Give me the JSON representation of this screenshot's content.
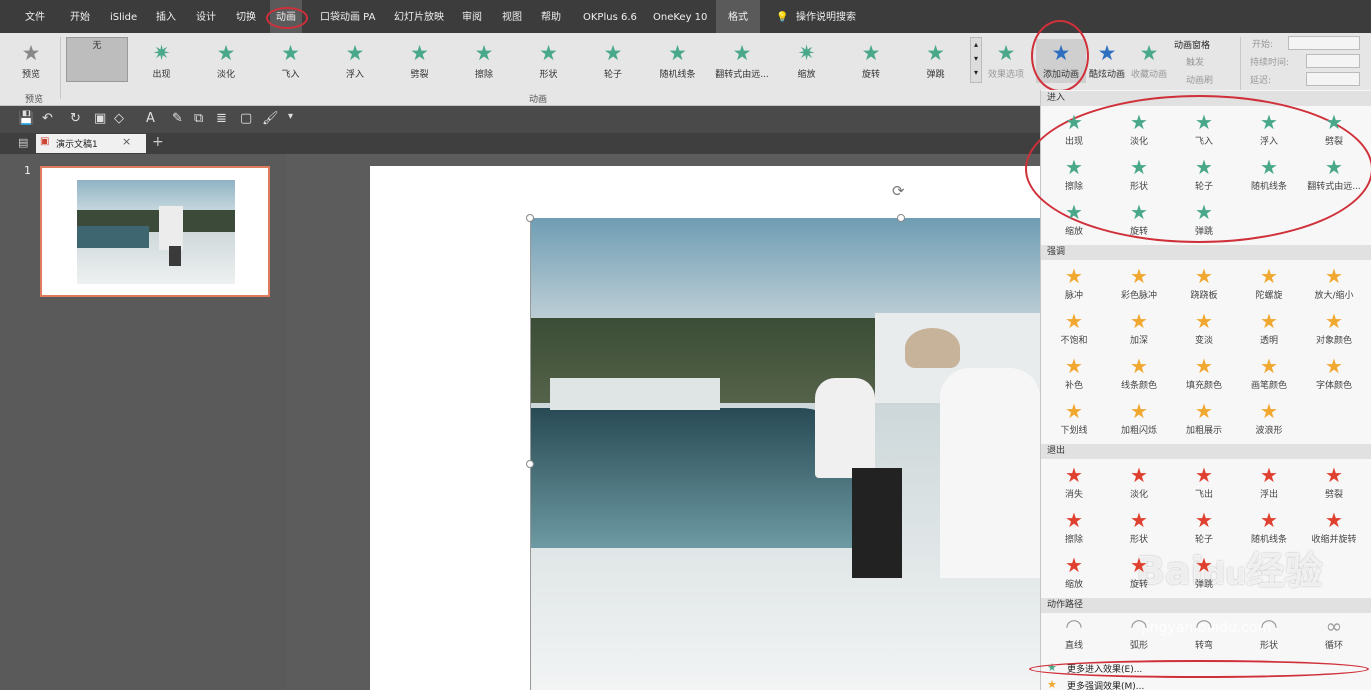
{
  "menu": {
    "tabs": [
      "文件",
      "开始",
      "iSlide",
      "插入",
      "设计",
      "切换",
      "动画",
      "口袋动画 PA",
      "幻灯片放映",
      "审阅",
      "视图",
      "帮助",
      "OKPlus 6.6",
      "OneKey 10",
      "格式"
    ],
    "active": "动画",
    "help_search": "操作说明搜索"
  },
  "ribbon": {
    "preview_label": "预览",
    "preview_group": "预览",
    "anim_group": "动画",
    "effects": [
      {
        "label": "无",
        "icon": "none"
      },
      {
        "label": "出现",
        "icon": "✷"
      },
      {
        "label": "淡化",
        "icon": "★"
      },
      {
        "label": "飞入",
        "icon": "★"
      },
      {
        "label": "浮入",
        "icon": "★"
      },
      {
        "label": "劈裂",
        "icon": "★"
      },
      {
        "label": "擦除",
        "icon": "★"
      },
      {
        "label": "形状",
        "icon": "★"
      },
      {
        "label": "轮子",
        "icon": "★"
      },
      {
        "label": "随机线条",
        "icon": "★"
      },
      {
        "label": "翻转式由远...",
        "icon": "★"
      },
      {
        "label": "缩放",
        "icon": "✷"
      },
      {
        "label": "旋转",
        "icon": "★"
      },
      {
        "label": "弹跳",
        "icon": "★"
      }
    ],
    "effect_options": "效果选项",
    "add_animation": "添加动画",
    "cool_animation": "酷炫动画",
    "fav_animation": "收藏动画",
    "anim_pane": "动画窗格",
    "trigger": "触发",
    "anim_brush": "动画刷",
    "start_label": "开始:",
    "duration_label": "持续时间:",
    "delay_label": "延迟:"
  },
  "tabstrip": {
    "doc_name": "演示文稿1"
  },
  "thumbs": {
    "slide_number": "1"
  },
  "panel": {
    "entrance_title": "进入",
    "entrance": [
      "出现",
      "淡化",
      "飞入",
      "浮入",
      "劈裂",
      "擦除",
      "形状",
      "轮子",
      "随机线条",
      "翻转式由远...",
      "缩放",
      "旋转",
      "弹跳"
    ],
    "emphasis_title": "强调",
    "emphasis": [
      "脉冲",
      "彩色脉冲",
      "跷跷板",
      "陀螺旋",
      "放大/缩小",
      "不饱和",
      "加深",
      "变淡",
      "透明",
      "对象颜色",
      "补色",
      "线条颜色",
      "填充颜色",
      "画笔颜色",
      "字体颜色",
      "下划线",
      "加粗闪烁",
      "加粗展示",
      "波浪形"
    ],
    "exit_title": "退出",
    "exit": [
      "消失",
      "淡化",
      "飞出",
      "浮出",
      "劈裂",
      "擦除",
      "形状",
      "轮子",
      "随机线条",
      "收缩并旋转",
      "缩放",
      "旋转",
      "弹跳"
    ],
    "path_title": "动作路径",
    "paths": [
      "直线",
      "弧形",
      "转弯",
      "形状",
      "循环"
    ],
    "more_entrance": "更多进入效果(E)...",
    "more_emphasis": "更多强调效果(M)..."
  },
  "watermark": {
    "brand": "Baidu经验",
    "url": "jingyan.baidu.com"
  }
}
